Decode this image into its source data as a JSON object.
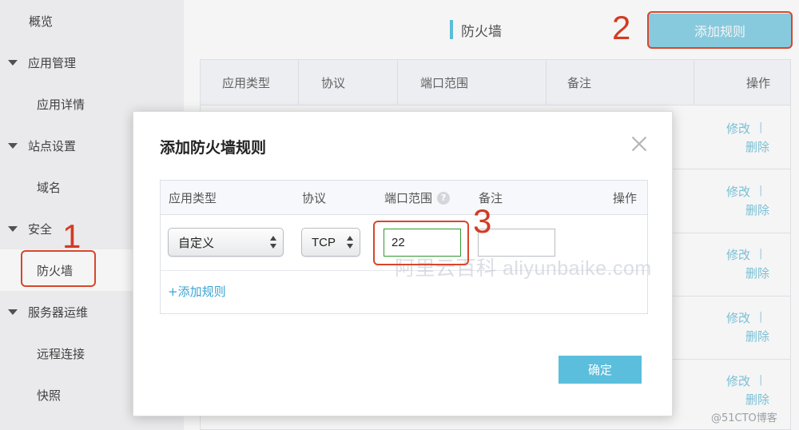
{
  "sidebar": {
    "items": [
      {
        "label": "概览",
        "type": "top"
      },
      {
        "label": "应用管理",
        "type": "group"
      },
      {
        "label": "应用详情",
        "type": "sub"
      },
      {
        "label": "站点设置",
        "type": "group"
      },
      {
        "label": "域名",
        "type": "sub"
      },
      {
        "label": "安全",
        "type": "group"
      },
      {
        "label": "防火墙",
        "type": "sub",
        "active": true
      },
      {
        "label": "服务器运维",
        "type": "group"
      },
      {
        "label": "远程连接",
        "type": "sub"
      },
      {
        "label": "快照",
        "type": "sub"
      }
    ]
  },
  "page": {
    "title": "防火墙",
    "add_rule_button": "添加规则"
  },
  "rules_table": {
    "headers": [
      "应用类型",
      "协议",
      "端口范围",
      "备注",
      "操作"
    ],
    "rows": [
      {
        "edit": "修改",
        "separator": "|",
        "delete": "删除"
      },
      {
        "edit": "修改",
        "separator": "|",
        "delete": "删除"
      },
      {
        "edit": "修改",
        "separator": "|",
        "delete": "删除"
      },
      {
        "edit": "修改",
        "separator": "|",
        "delete": "删除"
      },
      {
        "edit": "修改",
        "separator": "|",
        "delete": "删除"
      }
    ]
  },
  "modal": {
    "title": "添加防火墙规则",
    "headers": {
      "app_type": "应用类型",
      "protocol": "协议",
      "port_range": "端口范围",
      "note": "备注",
      "action": "操作"
    },
    "help_glyph": "?",
    "row": {
      "app_type": "自定义",
      "protocol": "TCP",
      "port": "22",
      "note": ""
    },
    "add_rule_link": "+添加规则",
    "confirm_button": "确定"
  },
  "annotations": {
    "step1": "1",
    "step2": "2",
    "step3": "3",
    "color": "#d23b23"
  },
  "watermark": "阿里云百科 aliyunbaike.com",
  "footer_watermark": "@51CTO博客",
  "colors": {
    "accent": "#5bbedc",
    "link": "#3aa4d2",
    "sidebar_bg": "#f4f4f6"
  }
}
